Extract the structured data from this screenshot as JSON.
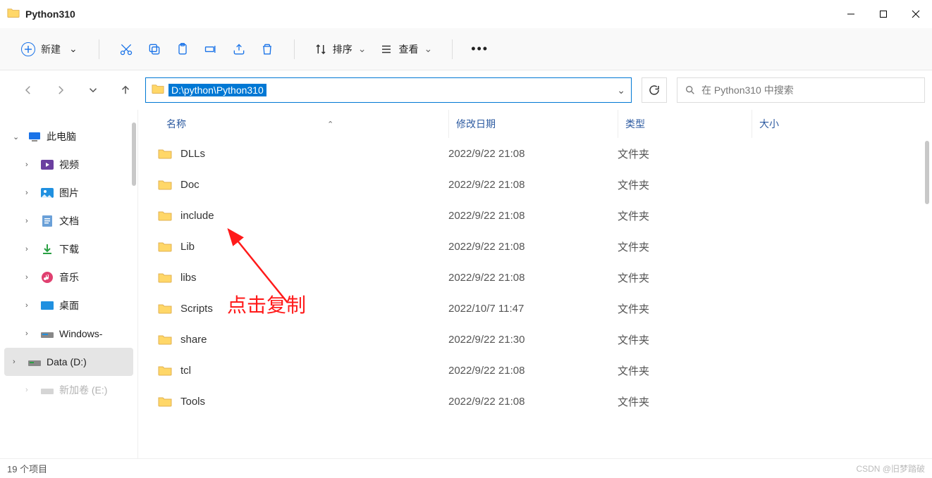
{
  "window": {
    "title": "Python310",
    "status": "19 个项目",
    "watermark": "CSDN @旧梦踏破"
  },
  "toolbar": {
    "new_label": "新建",
    "sort_label": "排序",
    "view_label": "查看"
  },
  "nav": {
    "path": "D:\\python\\Python310"
  },
  "search": {
    "placeholder": "在 Python310 中搜索"
  },
  "sidebar": {
    "items": [
      {
        "label": "此电脑",
        "icon": "pc"
      },
      {
        "label": "视频",
        "icon": "video"
      },
      {
        "label": "图片",
        "icon": "pictures"
      },
      {
        "label": "文档",
        "icon": "docs"
      },
      {
        "label": "下载",
        "icon": "download"
      },
      {
        "label": "音乐",
        "icon": "music"
      },
      {
        "label": "桌面",
        "icon": "desktop"
      },
      {
        "label": "Windows-",
        "icon": "drive"
      },
      {
        "label": "Data (D:)",
        "icon": "drive"
      },
      {
        "label": "新加卷 (E:)",
        "icon": "drive"
      }
    ]
  },
  "columns": {
    "name": "名称",
    "date": "修改日期",
    "type": "类型",
    "size": "大小"
  },
  "rows": [
    {
      "name": "DLLs",
      "date": "2022/9/22 21:08",
      "type": "文件夹"
    },
    {
      "name": "Doc",
      "date": "2022/9/22 21:08",
      "type": "文件夹"
    },
    {
      "name": "include",
      "date": "2022/9/22 21:08",
      "type": "文件夹"
    },
    {
      "name": "Lib",
      "date": "2022/9/22 21:08",
      "type": "文件夹"
    },
    {
      "name": "libs",
      "date": "2022/9/22 21:08",
      "type": "文件夹"
    },
    {
      "name": "Scripts",
      "date": "2022/10/7 11:47",
      "type": "文件夹"
    },
    {
      "name": "share",
      "date": "2022/9/22 21:30",
      "type": "文件夹"
    },
    {
      "name": "tcl",
      "date": "2022/9/22 21:08",
      "type": "文件夹"
    },
    {
      "name": "Tools",
      "date": "2022/9/22 21:08",
      "type": "文件夹"
    }
  ],
  "annotation": {
    "text": "点击复制"
  }
}
